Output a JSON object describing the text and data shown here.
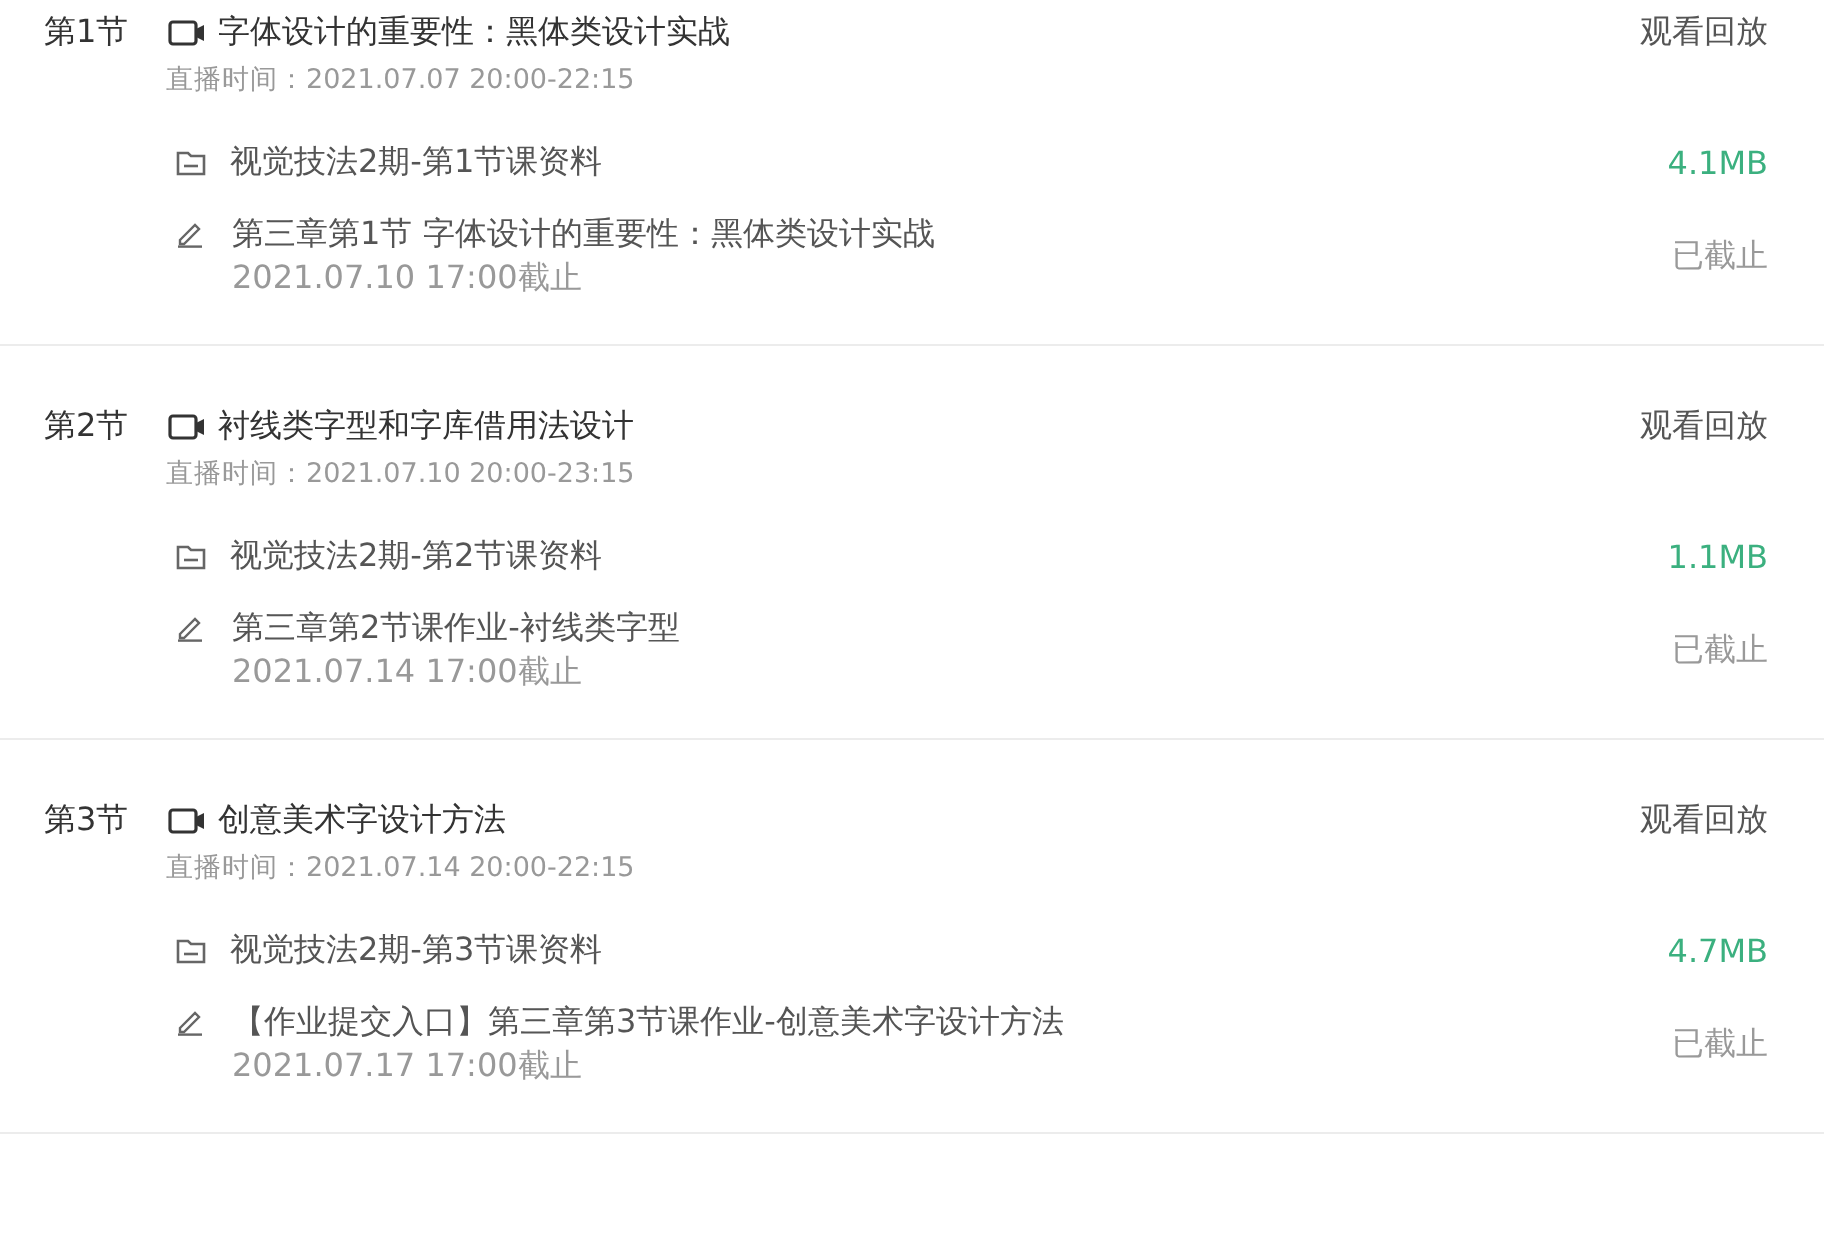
{
  "lessons": [
    {
      "index": "第1节",
      "title": "字体设计的重要性：黑体类设计实战",
      "live_time": "直播时间：2021.07.07 20:00-22:15",
      "replay": "观看回放",
      "material": {
        "name": "视觉技法2期-第1节课资料",
        "size": "4.1MB"
      },
      "homework": {
        "title": "第三章第1节 字体设计的重要性：黑体类设计实战",
        "deadline": "2021.07.10 17:00截止",
        "status": "已截止"
      }
    },
    {
      "index": "第2节",
      "title": "衬线类字型和字库借用法设计",
      "live_time": "直播时间：2021.07.10 20:00-23:15",
      "replay": "观看回放",
      "material": {
        "name": "视觉技法2期-第2节课资料",
        "size": "1.1MB"
      },
      "homework": {
        "title": "第三章第2节课作业-衬线类字型",
        "deadline": "2021.07.14 17:00截止",
        "status": "已截止"
      }
    },
    {
      "index": "第3节",
      "title": "创意美术字设计方法",
      "live_time": "直播时间：2021.07.14 20:00-22:15",
      "replay": "观看回放",
      "material": {
        "name": "视觉技法2期-第3节课资料",
        "size": "4.7MB"
      },
      "homework": {
        "title": "【作业提交入口】第三章第3节课作业-创意美术字设计方法",
        "deadline": "2021.07.17 17:00截止",
        "status": "已截止"
      }
    }
  ]
}
